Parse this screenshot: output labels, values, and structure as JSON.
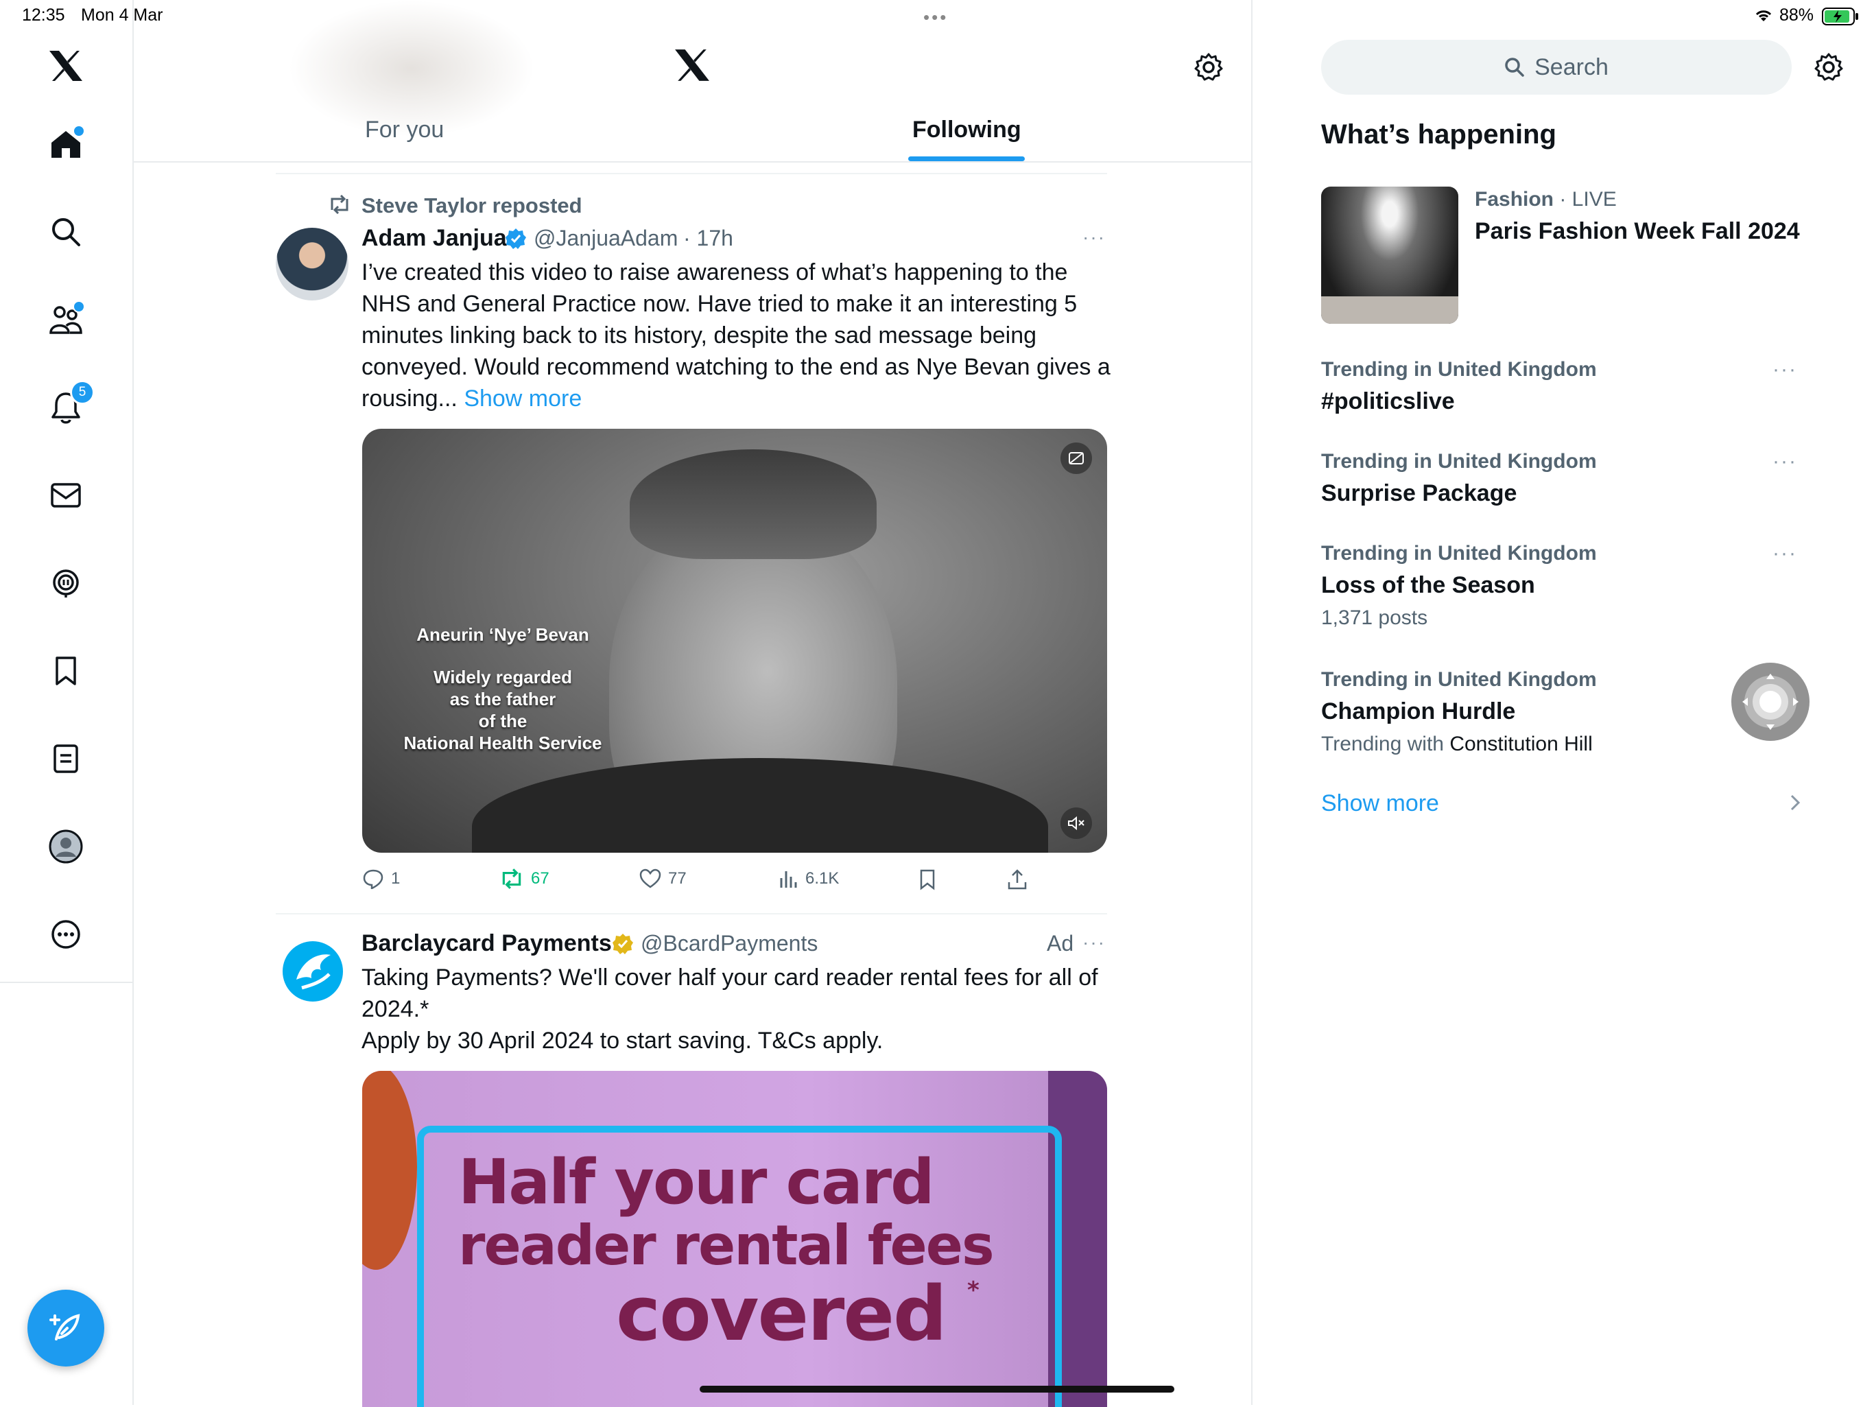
{
  "status_bar": {
    "time": "12:35",
    "date": "Mon 4 Mar",
    "battery": "88%"
  },
  "header": {
    "tabs": [
      {
        "label": "For you",
        "active": false
      },
      {
        "label": "Following",
        "active": true
      }
    ]
  },
  "nav": {
    "notifications_badge": "5"
  },
  "tweet1": {
    "repost_label": "Steve Taylor reposted",
    "author_name": "Adam Janjua",
    "handle": "@JanjuaAdam",
    "time": "· 17h",
    "text": "I’ve created this video to raise awareness of what’s happening to the NHS and General Practice now. Have tried to make it an interesting 5 minutes linking back to its history, despite the sad message being conveyed. Would recommend watching to the end as Nye Bevan gives a rousing...",
    "show_more": "Show more",
    "video_caption": {
      "name": "Aneurin ‘Nye’ Bevan",
      "line1": "Widely regarded",
      "line2": "as the father",
      "line3": "of the",
      "line4": "National Health Service"
    },
    "actions": {
      "replies": "1",
      "reposts": "67",
      "likes": "77",
      "views": "6.1K"
    }
  },
  "tweet2": {
    "author_name": "Barclaycard Payments",
    "handle": "@BcardPayments",
    "ad_label": "Ad",
    "text_line1": "Taking Payments? We'll cover half your card reader rental fees for all of 2024.*",
    "text_line2": "Apply by 30 April 2024 to start saving. T&Cs apply.",
    "image_text": {
      "line1": "Half your card",
      "line2": "reader rental fees",
      "line3": "covered",
      "asterisk": "*"
    }
  },
  "sidebar": {
    "search_placeholder": "Search",
    "heading": "What’s happening",
    "featured": {
      "category": "Fashion",
      "live": "· LIVE",
      "title": "Paris Fashion Week Fall 2024"
    },
    "trends": [
      {
        "label": "Trending in United Kingdom",
        "title": "#politicslive",
        "sub": ""
      },
      {
        "label": "Trending in United Kingdom",
        "title": "Surprise Package",
        "sub": ""
      },
      {
        "label": "Trending in United Kingdom",
        "title": "Loss of the Season",
        "sub": "1,371 posts"
      },
      {
        "label": "Trending in United Kingdom",
        "title": "Champion Hurdle",
        "sub_prefix": "Trending with",
        "sub_link": "Constitution Hill"
      }
    ],
    "show_more": "Show more"
  },
  "colors": {
    "accent": "#1d9bf0",
    "repost_green": "#00ba7c",
    "verified_gold": "#e2b719"
  }
}
